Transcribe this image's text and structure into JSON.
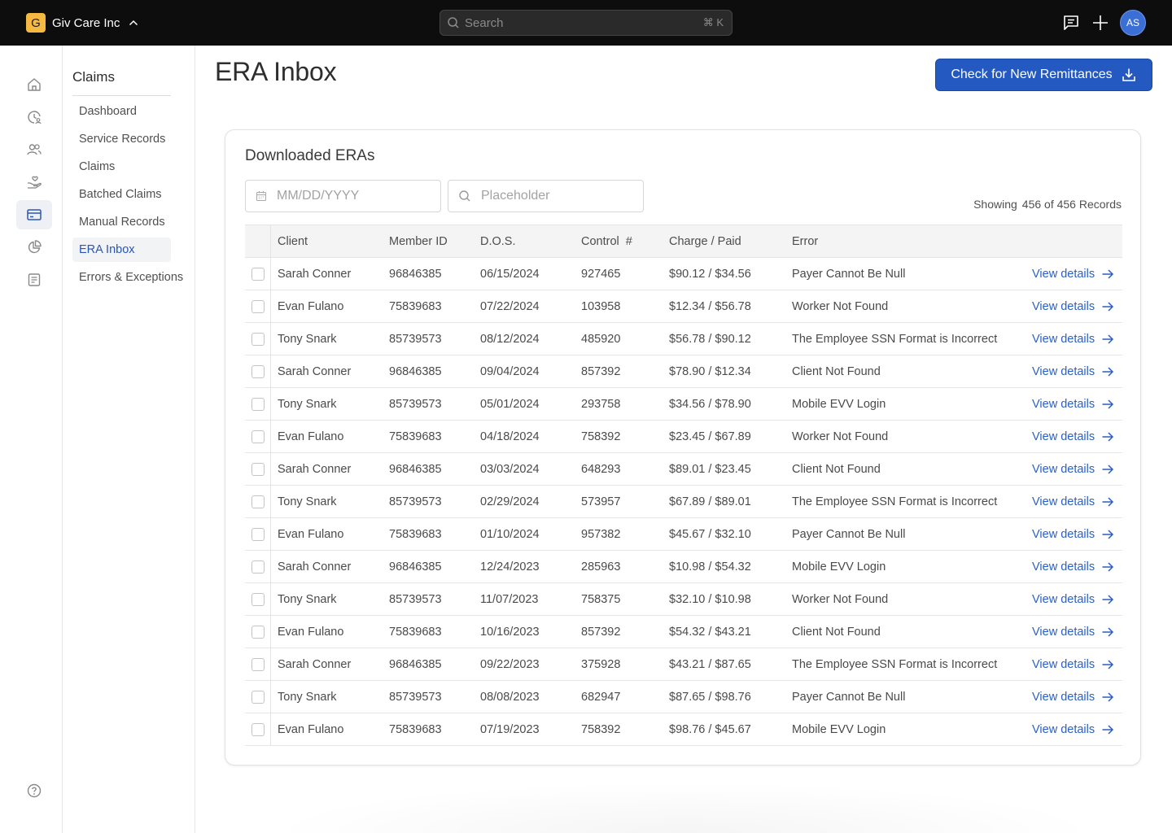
{
  "topbar": {
    "org_initial": "G",
    "org_name": "Giv Care Inc",
    "search_placeholder": "Search",
    "search_shortcut": "⌘ K",
    "avatar_initials": "AS"
  },
  "rail": {
    "items": [
      "home-icon",
      "clock-user-icon",
      "users-icon",
      "hand-heart-icon",
      "billing-card-icon",
      "pie-chart-icon",
      "report-icon"
    ],
    "active_index": 4,
    "help_icon": "help-icon"
  },
  "subnav": {
    "title": "Claims",
    "items": [
      "Dashboard",
      "Service Records",
      "Claims",
      "Batched Claims",
      "Manual Records",
      "ERA Inbox",
      "Errors & Exceptions"
    ],
    "active_index": 5
  },
  "main": {
    "title": "ERA Inbox",
    "primary_button": "Check for New Remittances"
  },
  "card": {
    "title": "Downloaded ERAs",
    "date_placeholder": "MM/DD/YYYY",
    "search_placeholder": "Placeholder",
    "showing_label": "Showing",
    "showing_count": "456 of 456 Records"
  },
  "table": {
    "headers": {
      "client": "Client",
      "member_id": "Member ID",
      "dos": "D.O.S.",
      "control": "Control  #",
      "charge_paid": "Charge / Paid",
      "error": "Error"
    },
    "link_label": "View details",
    "rows": [
      {
        "client": "Sarah Conner",
        "member_id": "96846385",
        "dos": "06/15/2024",
        "control": "927465",
        "charge_paid": "$90.12 / $34.56",
        "error": "Payer Cannot Be Null"
      },
      {
        "client": "Evan Fulano",
        "member_id": "75839683",
        "dos": "07/22/2024",
        "control": "103958",
        "charge_paid": "$12.34 / $56.78",
        "error": "Worker Not Found"
      },
      {
        "client": "Tony Snark",
        "member_id": "85739573",
        "dos": "08/12/2024",
        "control": "485920",
        "charge_paid": "$56.78 / $90.12",
        "error": "The Employee SSN Format is Incorrect"
      },
      {
        "client": "Sarah Conner",
        "member_id": "96846385",
        "dos": "09/04/2024",
        "control": "857392",
        "charge_paid": "$78.90 / $12.34",
        "error": "Client Not Found"
      },
      {
        "client": "Tony Snark",
        "member_id": "85739573",
        "dos": "05/01/2024",
        "control": "293758",
        "charge_paid": "$34.56 / $78.90",
        "error": "Mobile EVV Login"
      },
      {
        "client": "Evan Fulano",
        "member_id": "75839683",
        "dos": "04/18/2024",
        "control": "758392",
        "charge_paid": "$23.45 / $67.89",
        "error": "Worker Not Found"
      },
      {
        "client": "Sarah Conner",
        "member_id": "96846385",
        "dos": "03/03/2024",
        "control": "648293",
        "charge_paid": "$89.01 / $23.45",
        "error": "Client Not Found"
      },
      {
        "client": "Tony Snark",
        "member_id": "85739573",
        "dos": "02/29/2024",
        "control": "573957",
        "charge_paid": "$67.89 / $89.01",
        "error": "The Employee SSN Format is Incorrect"
      },
      {
        "client": "Evan Fulano",
        "member_id": "75839683",
        "dos": "01/10/2024",
        "control": "957382",
        "charge_paid": "$45.67 / $32.10",
        "error": "Payer Cannot Be Null"
      },
      {
        "client": "Sarah Conner",
        "member_id": "96846385",
        "dos": "12/24/2023",
        "control": "285963",
        "charge_paid": "$10.98 / $54.32",
        "error": "Mobile EVV Login"
      },
      {
        "client": "Tony Snark",
        "member_id": "85739573",
        "dos": "11/07/2023",
        "control": "758375",
        "charge_paid": "$32.10 / $10.98",
        "error": "Worker Not Found"
      },
      {
        "client": "Evan Fulano",
        "member_id": "75839683",
        "dos": "10/16/2023",
        "control": "857392",
        "charge_paid": "$54.32 / $43.21",
        "error": "Client Not Found"
      },
      {
        "client": "Sarah Conner",
        "member_id": "96846385",
        "dos": "09/22/2023",
        "control": "375928",
        "charge_paid": "$43.21 / $87.65",
        "error": "The Employee SSN Format is Incorrect"
      },
      {
        "client": "Tony Snark",
        "member_id": "85739573",
        "dos": "08/08/2023",
        "control": "682947",
        "charge_paid": "$87.65 / $98.76",
        "error": "Payer Cannot Be Null"
      },
      {
        "client": "Evan Fulano",
        "member_id": "75839683",
        "dos": "07/19/2023",
        "control": "758392",
        "charge_paid": "$98.76 / $45.67",
        "error": "Mobile EVV Login"
      }
    ]
  }
}
